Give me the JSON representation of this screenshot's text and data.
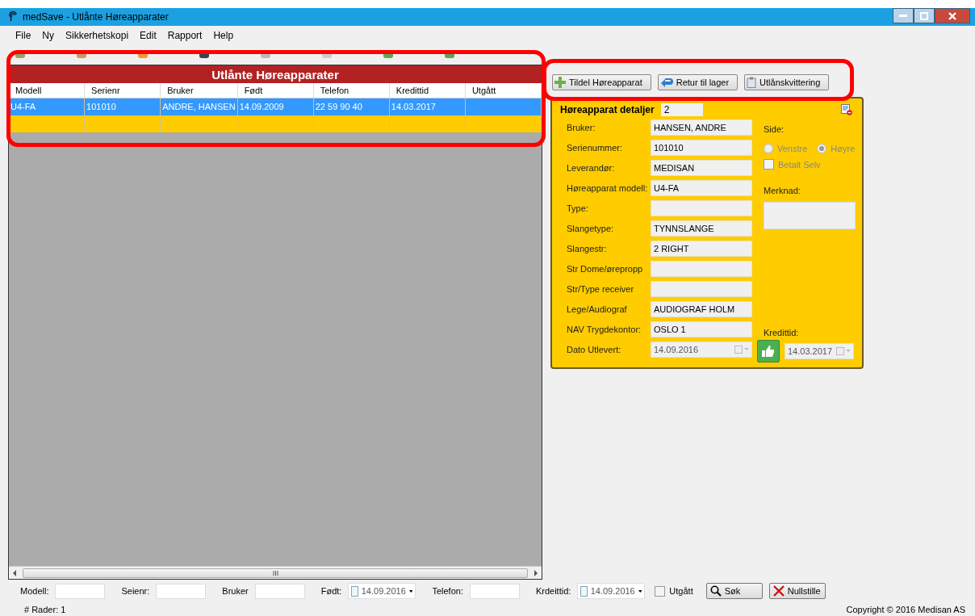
{
  "window": {
    "title": "medSave - Utlånte Høreapparater"
  },
  "menu": [
    {
      "label": "File"
    },
    {
      "label": "Ny"
    },
    {
      "label": "Sikkerhetskopi"
    },
    {
      "label": "Edit"
    },
    {
      "label": "Rapport"
    },
    {
      "label": "Help"
    }
  ],
  "loans_table": {
    "title": "Utlånte Høreapparater",
    "columns": [
      "Modell",
      "Serienr",
      "Bruker",
      "Født",
      "Telefon",
      "Kredittid",
      "Utgått"
    ],
    "rows": [
      {
        "kind": "data",
        "selected": true,
        "cells": [
          "U4-FA",
          "101010",
          "ANDRE, HANSEN",
          "14.09.2009",
          "22 59 90 40",
          "14.03.2017",
          ""
        ]
      },
      {
        "kind": "new",
        "selected": false
      }
    ]
  },
  "actions": [
    {
      "label": "Tildel Høreapparat",
      "kind": "assign"
    },
    {
      "label": "Retur til lager",
      "kind": "return"
    },
    {
      "label": "Utlånskvittering",
      "kind": "receipt"
    }
  ],
  "details": {
    "title": "Høreapparat detaljer",
    "id": "2",
    "fields": [
      {
        "label": "Bruker:",
        "value": "HANSEN, ANDRE",
        "kind": "text"
      },
      {
        "label": "Serienummer:",
        "value": "101010",
        "kind": "text"
      },
      {
        "label": "Leverandør:",
        "value": "MEDISAN",
        "kind": "text"
      },
      {
        "label": "Høreapparat modell:",
        "value": "U4-FA",
        "kind": "text"
      },
      {
        "label": "Type:",
        "kind": "text"
      },
      {
        "label": "Slangetype:",
        "value": "TYNNSLANGE",
        "kind": "text"
      },
      {
        "label": "Slangestr:",
        "value": "2 RIGHT",
        "kind": "text"
      },
      {
        "label": "Str Dome/ørepropp",
        "kind": "text"
      },
      {
        "label": "Str/Type receiver",
        "kind": "text"
      },
      {
        "label": "Lege/Audiograf",
        "value": "AUDIOGRAF HOLM",
        "kind": "text"
      },
      {
        "label": "NAV Trygdekontor:",
        "value": "OSLO 1",
        "kind": "text"
      },
      {
        "label": "Dato Utlevert:",
        "value": "14.09.2016",
        "kind": "date"
      }
    ],
    "side": {
      "label": "Side:",
      "disabled": true,
      "options": [
        {
          "label": "Venstre",
          "selected": false
        },
        {
          "label": "Høyre",
          "selected": true
        }
      ]
    },
    "paid_self": {
      "label": "Betalt Selv",
      "checked": false,
      "disabled": true
    },
    "note": {
      "label": "Merknad:"
    },
    "credit": {
      "label": "Kredittid:",
      "value": "14.03.2017"
    }
  },
  "filters": [
    {
      "label": "Modell:",
      "kind": "text"
    },
    {
      "label": "Seienr:",
      "kind": "text"
    },
    {
      "label": "Bruker",
      "kind": "text"
    },
    {
      "label": "Født:",
      "kind": "date",
      "value": "14.09.2016",
      "checked": false
    },
    {
      "label": "Telefon:",
      "kind": "text"
    },
    {
      "label": "Krdeittid:",
      "kind": "date",
      "value": "14.09.2016",
      "checked": false
    }
  ],
  "expired_filter": {
    "label": "Utgått",
    "checked": false
  },
  "buttons": [
    {
      "label": "Søk",
      "kind": "search"
    },
    {
      "label": "Nullstille",
      "kind": "reset"
    }
  ],
  "status": {
    "rows": "# Rader: 1",
    "copyright": "Copyright © 2016 Medisan AS"
  }
}
